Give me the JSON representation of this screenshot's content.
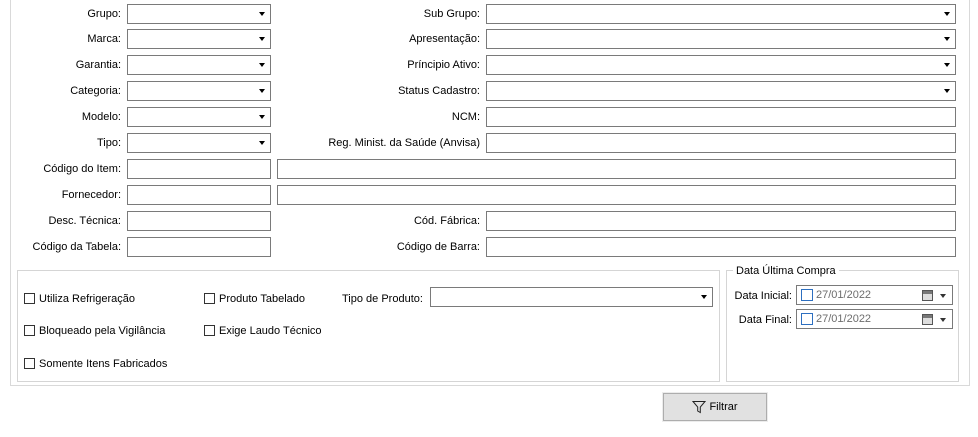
{
  "filters": {
    "grupo": {
      "label": "Grupo:",
      "value": ""
    },
    "marca": {
      "label": "Marca:",
      "value": ""
    },
    "garantia": {
      "label": "Garantia:",
      "value": ""
    },
    "categoria": {
      "label": "Categoria:",
      "value": ""
    },
    "modelo": {
      "label": "Modelo:",
      "value": ""
    },
    "tipo": {
      "label": "Tipo:",
      "value": ""
    },
    "codigo_item": {
      "label": "Código do Item:",
      "value": "",
      "desc_value": ""
    },
    "fornecedor": {
      "label": "Fornecedor:",
      "value": "",
      "desc_value": ""
    },
    "desc_tecnica": {
      "label": "Desc. Técnica:",
      "value": ""
    },
    "codigo_tabela": {
      "label": "Código da Tabela:",
      "value": ""
    },
    "sub_grupo": {
      "label": "Sub Grupo:",
      "value": ""
    },
    "apresentacao": {
      "label": "Apresentação:",
      "value": ""
    },
    "principio_ativo": {
      "label": "Príncipio Ativo:",
      "value": ""
    },
    "status_cadastro": {
      "label": "Status Cadastro:",
      "value": ""
    },
    "ncm": {
      "label": "NCM:",
      "value": ""
    },
    "reg_minist": {
      "label": "Reg. Minist. da Saúde (Anvisa)",
      "value": ""
    },
    "cod_fabrica": {
      "label": "Cód. Fábrica:",
      "value": ""
    },
    "codigo_barra": {
      "label": "Código de Barra:",
      "value": ""
    }
  },
  "options": {
    "utiliza_refrigeracao": {
      "label": "Utiliza Refrigeração",
      "checked": false
    },
    "bloqueado_vigilancia": {
      "label": "Bloqueado pela Vigilância",
      "checked": false
    },
    "somente_fabricados": {
      "label": "Somente Itens Fabricados",
      "checked": false
    },
    "produto_tabelado": {
      "label": "Produto Tabelado",
      "checked": false
    },
    "exige_laudo": {
      "label": "Exige Laudo Técnico",
      "checked": false
    },
    "tipo_produto": {
      "label": "Tipo de Produto:",
      "value": ""
    }
  },
  "data_ultima_compra": {
    "title": "Data Última Compra",
    "inicial": {
      "label": "Data Inicial:",
      "value": "27/01/2022"
    },
    "final": {
      "label": "Data Final:",
      "value": "27/01/2022"
    }
  },
  "filtrar_button": {
    "label": "Filtrar",
    "icon": "filter-icon"
  }
}
